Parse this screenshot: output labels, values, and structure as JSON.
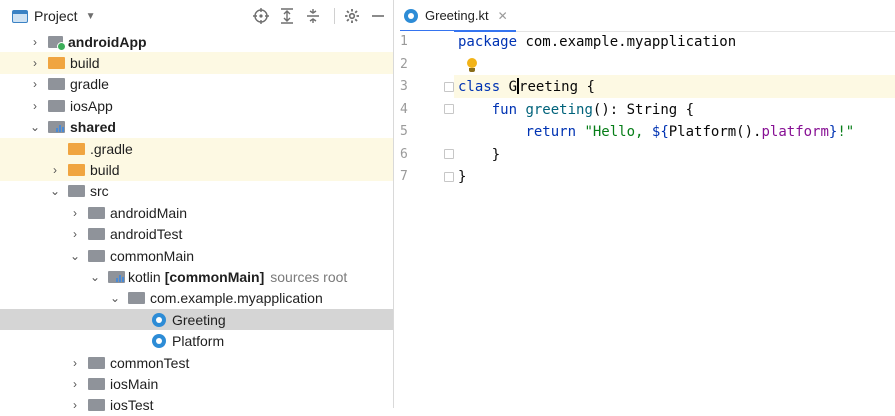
{
  "project_panel": {
    "title": "Project",
    "icons": [
      "locate-icon",
      "expand-all-icon",
      "collapse-all-icon",
      "gear-icon",
      "minimize-icon"
    ]
  },
  "tree": [
    {
      "label": "androidApp",
      "bold": true
    },
    {
      "label": "build"
    },
    {
      "label": "gradle"
    },
    {
      "label": "iosApp"
    },
    {
      "label": "shared",
      "bold": true
    },
    {
      "label": ".gradle"
    },
    {
      "label": "build"
    },
    {
      "label": "src"
    },
    {
      "label": "androidMain"
    },
    {
      "label": "androidTest"
    },
    {
      "label": "commonMain"
    },
    {
      "label": "kotlin",
      "bold_part": "[commonMain]",
      "suffix": "sources root"
    },
    {
      "label": "com.example.myapplication"
    },
    {
      "label": "Greeting"
    },
    {
      "label": "Platform"
    },
    {
      "label": "commonTest"
    },
    {
      "label": "iosMain"
    },
    {
      "label": "iosTest"
    }
  ],
  "editor": {
    "tab_label": "Greeting.kt",
    "line_numbers": [
      "1",
      "2",
      "3",
      "4",
      "5",
      "6",
      "7"
    ],
    "lines": {
      "l1_kw": "package",
      "l1_rest": " com.example.myapplication",
      "l3_kw": "class",
      "l3_name_a": "G",
      "l3_name_b": "reeting",
      "l3_rest": " {",
      "l4_indent": "    ",
      "l4_kw": "fun",
      "l4_sp": " ",
      "l4_fn": "greeting",
      "l4_rest": "(): String {",
      "l5_indent": "        ",
      "l5_kw": "return",
      "l5_sp": " ",
      "l5_str1": "\"Hello, ",
      "l5_tpl_open": "${",
      "l5_call": "Platform()",
      "l5_dot": ".",
      "l5_prop": "platform",
      "l5_tpl_close": "}",
      "l5_str2": "!\"",
      "l6": "    }",
      "l7": "}"
    }
  }
}
